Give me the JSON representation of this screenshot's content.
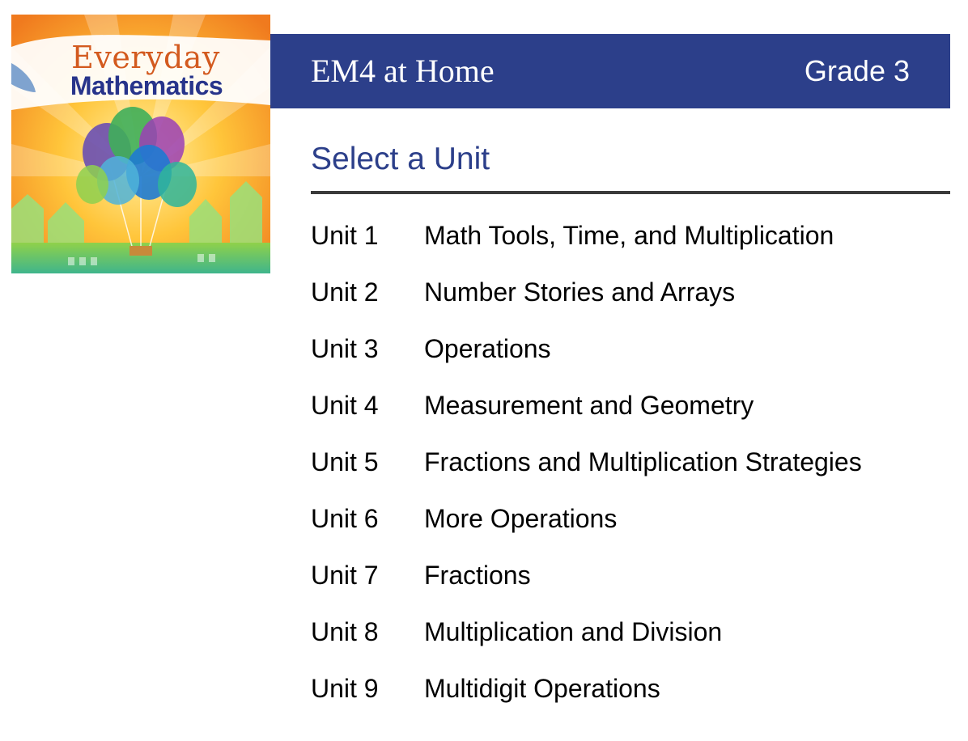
{
  "cover": {
    "wordmark_line1": "Everyday",
    "wordmark_line2": "Mathematics",
    "image_icon": "balloons-over-town-illustration"
  },
  "header": {
    "title": "EM4 at Home",
    "grade": "Grade 3",
    "background_color": "#2c3f8a"
  },
  "main": {
    "section_title": "Select a Unit",
    "units": [
      {
        "number": "Unit 1",
        "name": "Math Tools, Time, and Multiplication"
      },
      {
        "number": "Unit 2",
        "name": "Number Stories and Arrays"
      },
      {
        "number": "Unit 3",
        "name": "Operations"
      },
      {
        "number": "Unit 4",
        "name": "Measurement and Geometry"
      },
      {
        "number": "Unit 5",
        "name": "Fractions and Multiplication Strategies"
      },
      {
        "number": "Unit 6",
        "name": "More Operations"
      },
      {
        "number": "Unit 7",
        "name": "Fractions"
      },
      {
        "number": "Unit 8",
        "name": "Multiplication and Division"
      },
      {
        "number": "Unit 9",
        "name": "Multidigit Operations"
      }
    ]
  },
  "colors": {
    "accent": "#2c3f8a",
    "rule": "#3a3a3a",
    "text": "#000000"
  }
}
